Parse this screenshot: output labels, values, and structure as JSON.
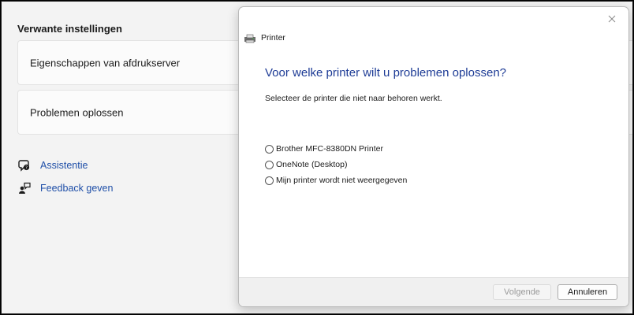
{
  "settings": {
    "section_title": "Verwante instellingen",
    "cards": [
      {
        "label": "Eigenschappen van afdrukserver"
      },
      {
        "label": "Problemen oplossen"
      }
    ],
    "links": [
      {
        "label": "Assistentie",
        "icon": "help-chat-icon"
      },
      {
        "label": "Feedback geven",
        "icon": "feedback-icon"
      }
    ]
  },
  "dialog": {
    "caption": "Printer",
    "question": "Voor welke printer wilt u problemen oplossen?",
    "instruction": "Selecteer de printer die niet naar behoren werkt.",
    "options": [
      {
        "label": "Brother MFC-8380DN Printer",
        "selected": false
      },
      {
        "label": "OneNote (Desktop)",
        "selected": false
      },
      {
        "label": "Mijn printer wordt niet weergegeven",
        "selected": false
      }
    ],
    "next_label": "Volgende",
    "next_enabled": false,
    "cancel_label": "Annuleren"
  },
  "colors": {
    "link": "#1f4fa8",
    "question": "#1e3c96",
    "background": "#f3f3f3"
  }
}
